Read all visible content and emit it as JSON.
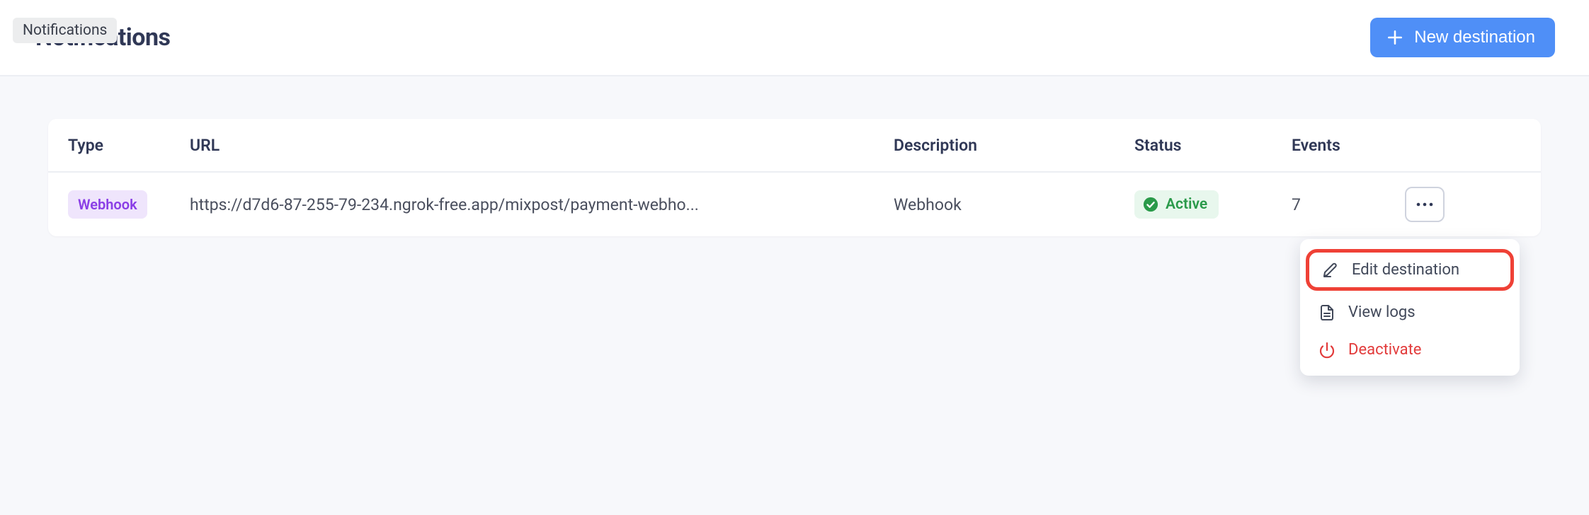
{
  "tooltip": "Notifications",
  "page_title": "Notifications",
  "new_destination_label": "New destination",
  "columns": {
    "type": "Type",
    "url": "URL",
    "description": "Description",
    "status": "Status",
    "events": "Events"
  },
  "row": {
    "type_badge": "Webhook",
    "url": "https://d7d6-87-255-79-234.ngrok-free.app/mixpost/payment-webho...",
    "description": "Webhook",
    "status_label": "Active",
    "events": "7"
  },
  "menu": {
    "edit": "Edit destination",
    "logs": "View logs",
    "deactivate": "Deactivate"
  }
}
